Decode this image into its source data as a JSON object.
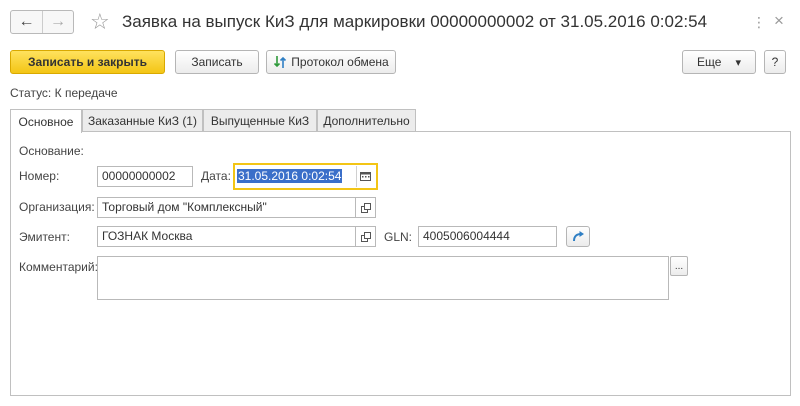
{
  "window": {
    "title": "Заявка на выпуск КиЗ для маркировки 00000000002 от 31.05.2016 0:02:54",
    "back_icon": "←",
    "forward_icon": "→",
    "star_icon": "☆",
    "more_icon": "⋮",
    "close_icon": "×"
  },
  "toolbar": {
    "save_close_label": "Записать и закрыть",
    "save_label": "Записать",
    "exchange_log_label": "Протокол обмена",
    "more_label": "Еще",
    "more_arrow": "▾",
    "help_label": "?"
  },
  "status": {
    "label": "Статус:",
    "value": "К передаче"
  },
  "tabs": [
    {
      "label": "Основное",
      "active": true
    },
    {
      "label": "Заказанные КиЗ (1)",
      "active": false
    },
    {
      "label": "Выпущенные КиЗ",
      "active": false
    },
    {
      "label": "Дополнительно",
      "active": false
    }
  ],
  "form": {
    "basis_label": "Основание:",
    "number_label": "Номер:",
    "number_value": "00000000002",
    "date_label": "Дата:",
    "date_value": "31.05.2016  0:02:54",
    "organization_label": "Организация:",
    "organization_value": "Торговый дом \"Комплексный\"",
    "issuer_label": "Эмитент:",
    "issuer_value": "ГОЗНАК Москва",
    "gln_label": "GLN:",
    "gln_value": "4005006004444",
    "comment_label": "Комментарий:",
    "comment_value": "",
    "comment_more": "..."
  },
  "colors": {
    "primary_button": "#f3c515",
    "focus_border": "#f3c515",
    "selection": "#3b6fc9",
    "refresh_arrow": "#2f7fc4"
  }
}
